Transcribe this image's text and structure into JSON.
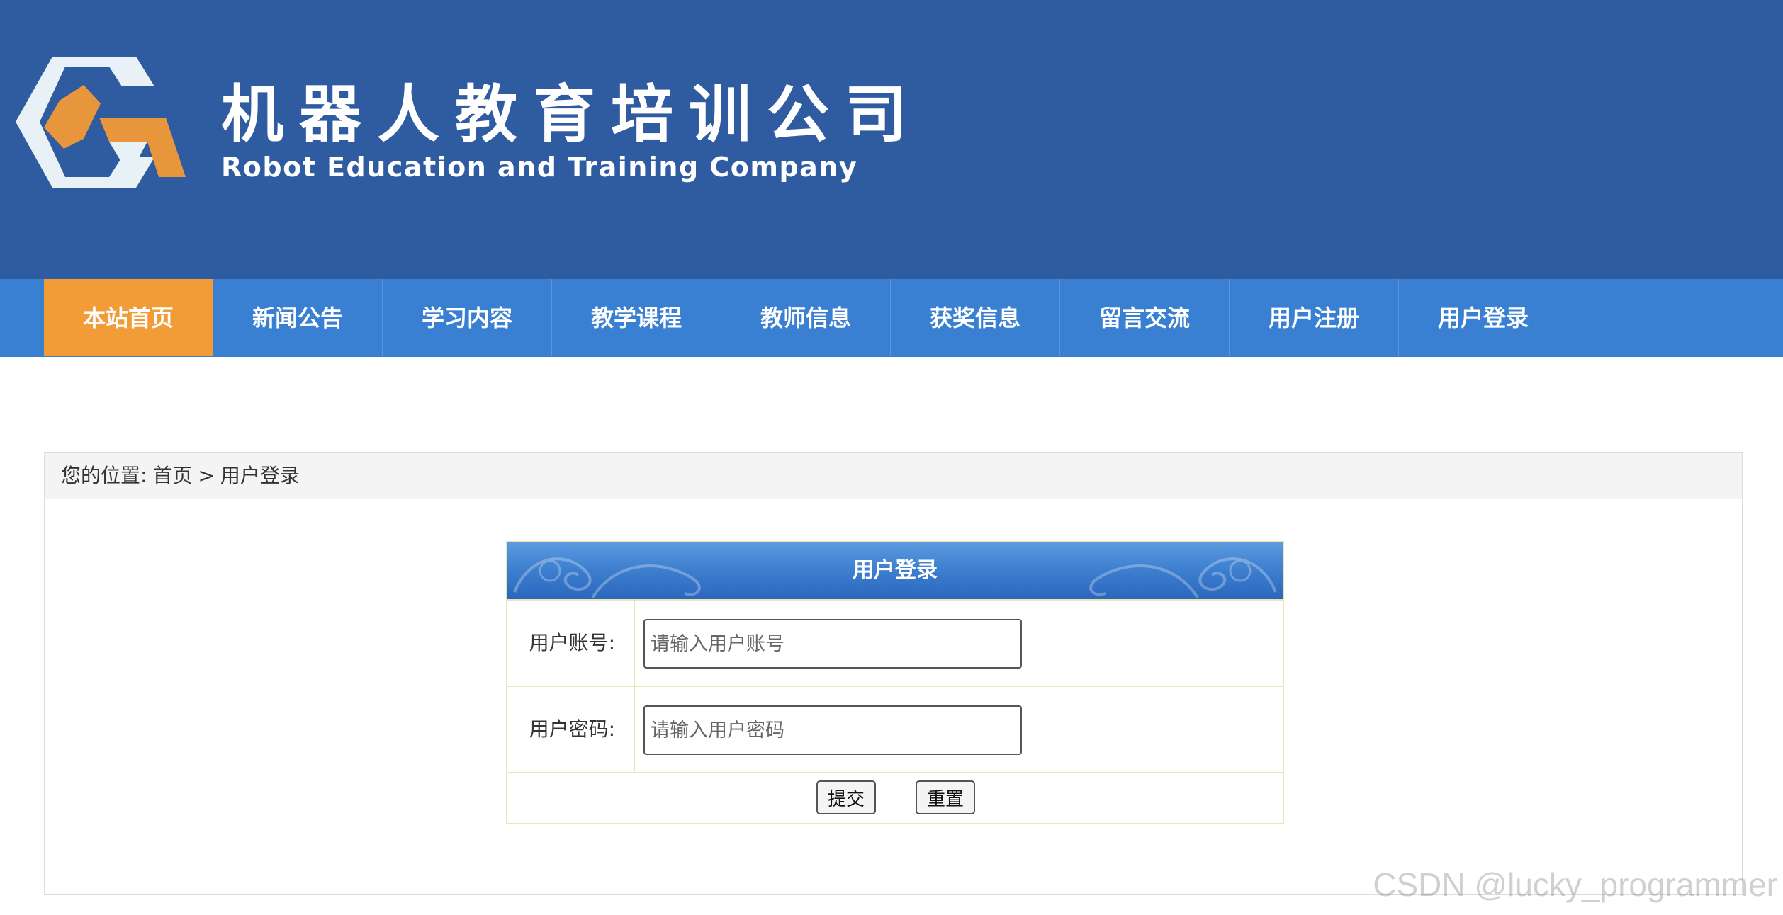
{
  "header": {
    "title_cn": "机器人教育培训公司",
    "title_en": "Robot Education and Training Company",
    "colors": {
      "banner": "#2f5ba1",
      "logo_orange": "#e8963c",
      "logo_white": "#e8f1f6"
    }
  },
  "nav": {
    "items": [
      {
        "label": "本站首页",
        "active": true
      },
      {
        "label": "新闻公告",
        "active": false
      },
      {
        "label": "学习内容",
        "active": false
      },
      {
        "label": "教学课程",
        "active": false
      },
      {
        "label": "教师信息",
        "active": false
      },
      {
        "label": "获奖信息",
        "active": false
      },
      {
        "label": "留言交流",
        "active": false
      },
      {
        "label": "用户注册",
        "active": false
      },
      {
        "label": "用户登录",
        "active": false
      }
    ],
    "colors": {
      "bar": "#3a80d2",
      "active": "#f29c38"
    }
  },
  "breadcrumb": {
    "prefix": "您的位置:",
    "home": "首页",
    "separator": ">",
    "current": "用户登录"
  },
  "login_form": {
    "title": "用户登录",
    "account_label": "用户账号:",
    "account_placeholder": "请输入用户账号",
    "password_label": "用户密码:",
    "password_placeholder": "请输入用户密码",
    "submit_label": "提交",
    "reset_label": "重置"
  },
  "watermark": "CSDN @lucky_programmer"
}
